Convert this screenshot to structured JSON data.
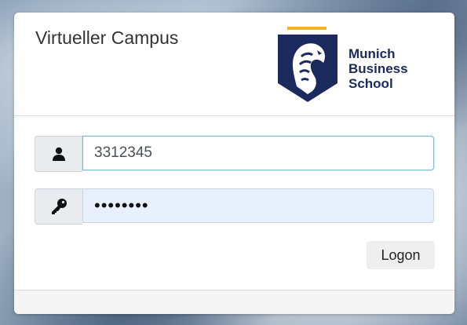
{
  "header": {
    "title": "Virtueller Campus"
  },
  "logo": {
    "icon": "lion-shield-logo",
    "line1": "Munich",
    "line2": "Business",
    "line3": "School",
    "brand_color": "#1b2a5c",
    "accent_color": "#f0b323"
  },
  "form": {
    "username": {
      "icon": "user-icon",
      "value": "3312345"
    },
    "password": {
      "icon": "key-icon",
      "value": "••••••••"
    },
    "logon_label": "Logon"
  }
}
